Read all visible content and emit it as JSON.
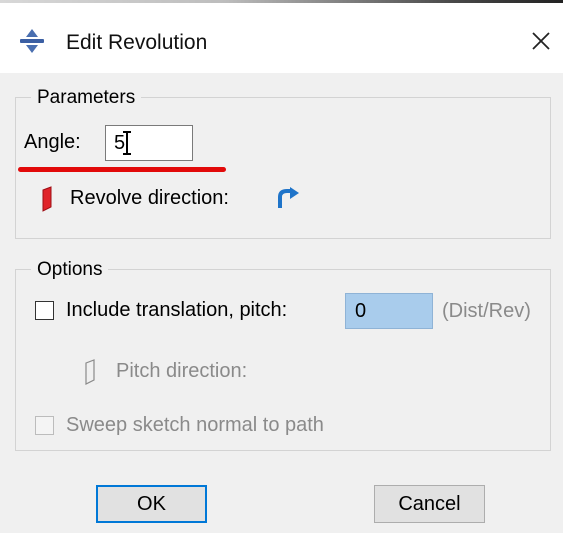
{
  "window": {
    "title": "Edit Revolution",
    "close_glyph": "✕",
    "title_icon": "revolve-feature-icon"
  },
  "parameters": {
    "group_label": "Parameters",
    "angle_label": "Angle:",
    "angle_value": "5",
    "revolve_direction_label": "Revolve direction:",
    "revolve_direction_icon": "curved-arrow-icon",
    "annotation_color": "#e20a0a"
  },
  "options": {
    "group_label": "Options",
    "include_translation_label": "Include translation, pitch:",
    "include_translation_checked": false,
    "pitch_value": "0",
    "pitch_unit": "(Dist/Rev)",
    "pitch_direction_label": "Pitch direction:",
    "sweep_label": "Sweep sketch normal to path",
    "sweep_checked": false
  },
  "buttons": {
    "ok": "OK",
    "cancel": "Cancel"
  },
  "colors": {
    "accent": "#0078d7",
    "pitch_field_bg": "#a9ccec",
    "direction_arrow": "#1f74c9",
    "flag_red": "#e0242a"
  }
}
